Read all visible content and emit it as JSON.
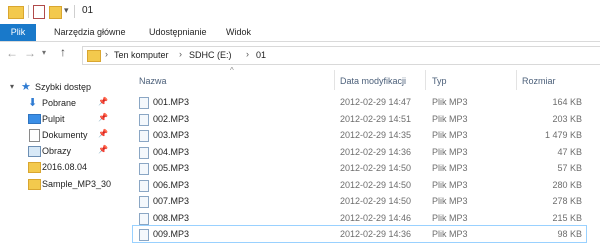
{
  "window": {
    "title": "01"
  },
  "ribbon": {
    "tabs": [
      "Plik",
      "Narzędzia główne",
      "Udostępnianie",
      "Widok"
    ]
  },
  "address": {
    "path": [
      "Ten komputer",
      "SDHC (E:)",
      "01"
    ]
  },
  "nav": {
    "items": [
      {
        "label": "Szybki dostęp",
        "icon": "star-icon"
      },
      {
        "label": "Pobrane",
        "icon": "download-icon"
      },
      {
        "label": "Pulpit",
        "icon": "desktop-icon"
      },
      {
        "label": "Dokumenty",
        "icon": "documents-icon"
      },
      {
        "label": "Obrazy",
        "icon": "pictures-icon"
      },
      {
        "label": "2016.08.04",
        "icon": "folder-icon"
      },
      {
        "label": "Sample_MP3_30",
        "icon": "folder-icon"
      }
    ]
  },
  "columns": {
    "name": "Nazwa",
    "date": "Data modyfikacji",
    "type": "Typ",
    "size": "Rozmiar"
  },
  "files": [
    {
      "name": "001.MP3",
      "date": "2012-02-29 14:47",
      "type": "Plik MP3",
      "size": "164 KB"
    },
    {
      "name": "002.MP3",
      "date": "2012-02-29 14:51",
      "type": "Plik MP3",
      "size": "203 KB"
    },
    {
      "name": "003.MP3",
      "date": "2012-02-29 14:35",
      "type": "Plik MP3",
      "size": "1 479 KB"
    },
    {
      "name": "004.MP3",
      "date": "2012-02-29 14:36",
      "type": "Plik MP3",
      "size": "47 KB"
    },
    {
      "name": "005.MP3",
      "date": "2012-02-29 14:50",
      "type": "Plik MP3",
      "size": "57 KB"
    },
    {
      "name": "006.MP3",
      "date": "2012-02-29 14:50",
      "type": "Plik MP3",
      "size": "280 KB"
    },
    {
      "name": "007.MP3",
      "date": "2012-02-29 14:50",
      "type": "Plik MP3",
      "size": "278 KB"
    },
    {
      "name": "008.MP3",
      "date": "2012-02-29 14:46",
      "type": "Plik MP3",
      "size": "215 KB"
    },
    {
      "name": "009.MP3",
      "date": "2012-02-29 14:36",
      "type": "Plik MP3",
      "size": "98 KB"
    }
  ],
  "colors": {
    "accent": "#1979ca",
    "selection": "#99d1ff"
  }
}
